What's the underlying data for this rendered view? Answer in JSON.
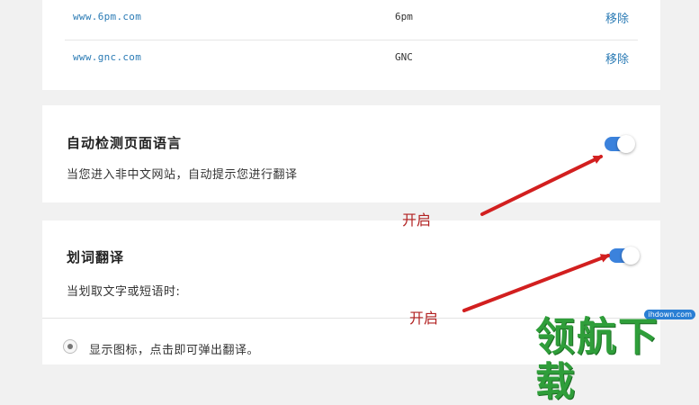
{
  "sites": {
    "rows": [
      {
        "url": "www.6pm.com",
        "name": "6pm",
        "action": "移除"
      },
      {
        "url": "www.gnc.com",
        "name": "GNC",
        "action": "移除"
      }
    ]
  },
  "auto_detect": {
    "title": "自动检测页面语言",
    "description": "当您进入非中文网站，自动提示您进行翻译",
    "enabled": true
  },
  "word_translate": {
    "title": "划词翻译",
    "description": "当划取文字或短语时:",
    "enabled": true,
    "option_label": "显示图标，点击即可弹出翻译。",
    "option_selected": true
  },
  "annotations": {
    "label_1": "开启",
    "label_2": "开启",
    "color": "#b22222"
  },
  "watermark": {
    "url": "ihdown.com",
    "text": "领航下载"
  },
  "colors": {
    "toggle_on": "#3b82dc",
    "link": "#2b7bb5",
    "background": "#f1f1f1"
  }
}
